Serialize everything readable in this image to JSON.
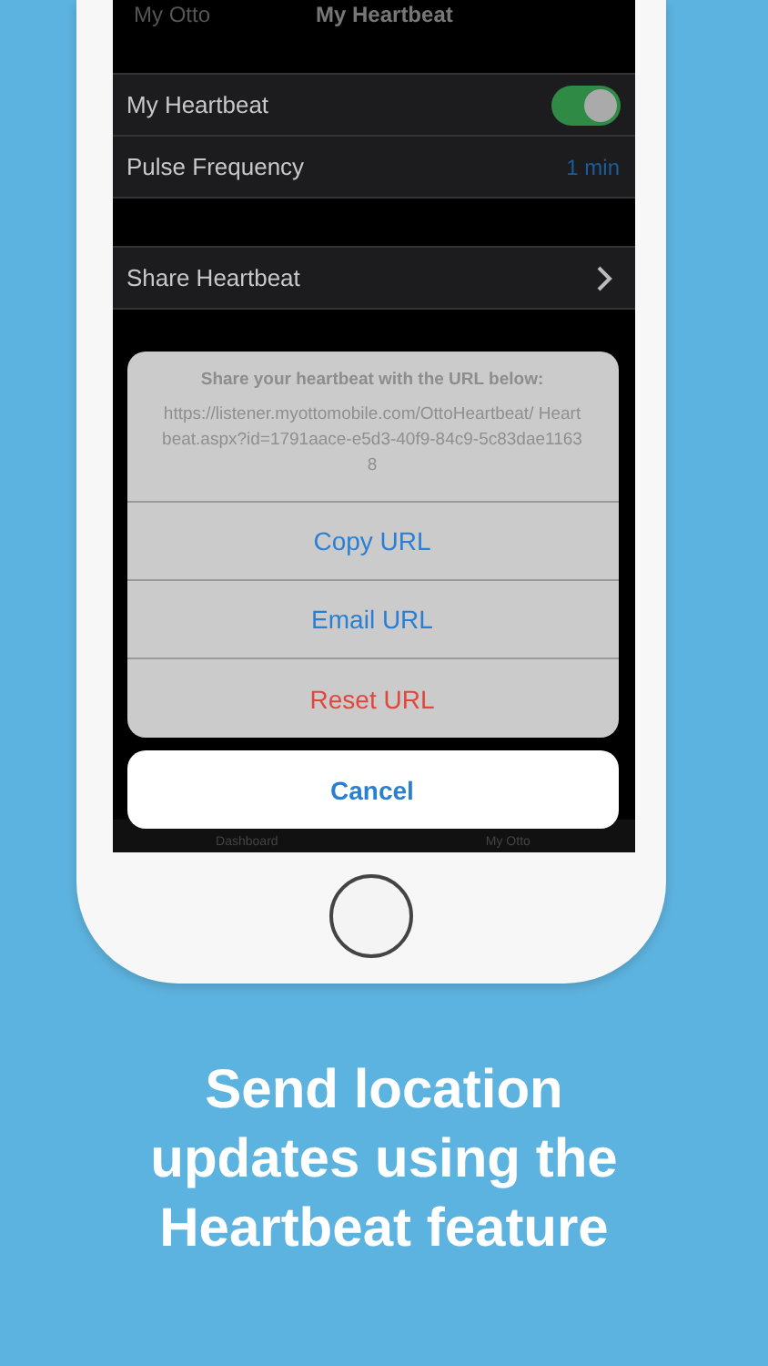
{
  "nav": {
    "back": "My Otto",
    "title": "My Heartbeat"
  },
  "groups": [
    {
      "rows": [
        {
          "kind": "toggle",
          "label": "My Heartbeat",
          "on": true
        },
        {
          "kind": "value",
          "label": "Pulse Frequency",
          "value": "1 min"
        }
      ]
    },
    {
      "rows": [
        {
          "kind": "disclosure",
          "label": "Share Heartbeat"
        }
      ]
    }
  ],
  "tab_bar": {
    "items": [
      "Dashboard",
      "My Otto"
    ]
  },
  "action_sheet": {
    "title": "Share your heartbeat with the URL below:",
    "message": "https://listener.myottomobile.com/OttoHeartbeat/ Heartbeat.aspx?id=1791aace-e5d3-40f9-84c9-5c83dae11638",
    "actions": [
      {
        "label": "Copy URL",
        "kind": "default"
      },
      {
        "label": "Email URL",
        "kind": "default"
      },
      {
        "label": "Reset URL",
        "kind": "destructive"
      }
    ],
    "cancel": "Cancel"
  },
  "caption": "Send location updates using the Heartbeat feature"
}
